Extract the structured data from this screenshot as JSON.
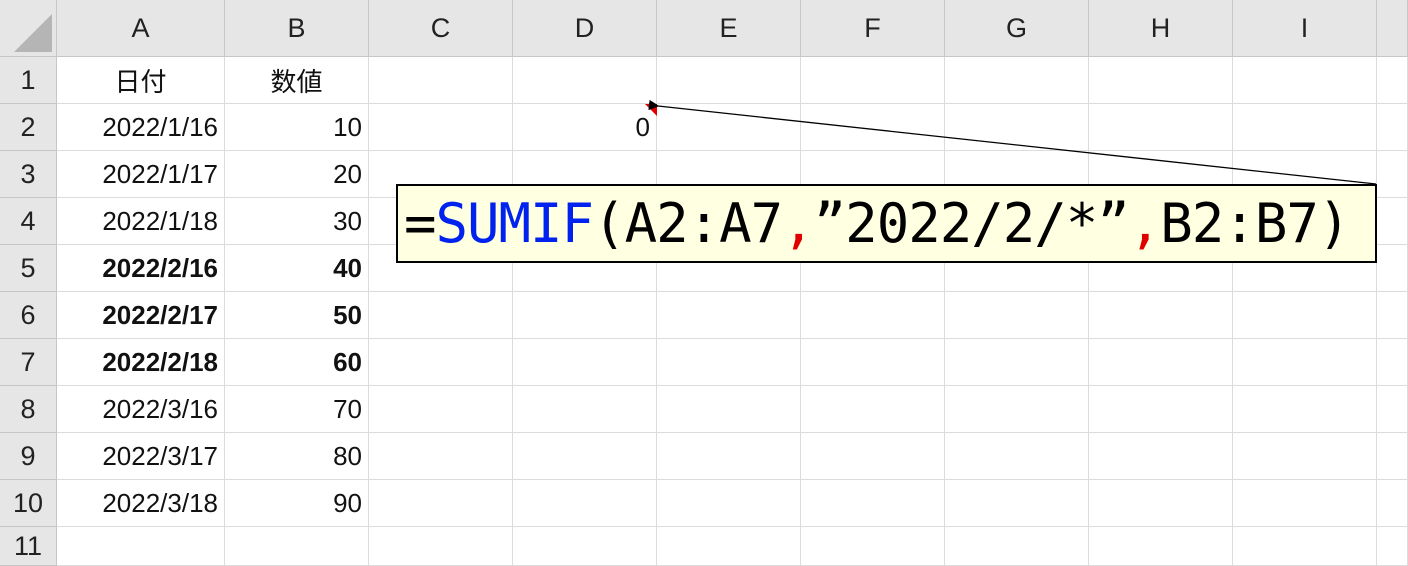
{
  "columns": [
    "A",
    "B",
    "C",
    "D",
    "E",
    "F",
    "G",
    "H",
    "I"
  ],
  "rows": [
    "1",
    "2",
    "3",
    "4",
    "5",
    "6",
    "7",
    "8",
    "9",
    "10",
    "11"
  ],
  "cells": {
    "A1": "日付",
    "B1": "数値",
    "A2": "2022/1/16",
    "B2": "10",
    "D2": "0",
    "A3": "2022/1/17",
    "B3": "20",
    "A4": "2022/1/18",
    "B4": "30",
    "A5": "2022/2/16",
    "B5": "40",
    "A6": "2022/2/17",
    "B6": "50",
    "A7": "2022/2/18",
    "B7": "60",
    "A8": "2022/3/16",
    "B8": "70",
    "A9": "2022/3/17",
    "B9": "80",
    "A10": "2022/3/18",
    "B10": "90"
  },
  "formula_note": {
    "eq": "=",
    "func": "SUMIF",
    "open": "(A2:A7",
    "comma1": ",",
    "criteria": "”2022/2/*”",
    "comma2": ",",
    "rest": "B2:B7)"
  },
  "colors": {
    "header_bg": "#e6e6e6",
    "note_bg": "#ffffe1",
    "function_blue": "#0022ee",
    "separator_red": "#e00000"
  }
}
